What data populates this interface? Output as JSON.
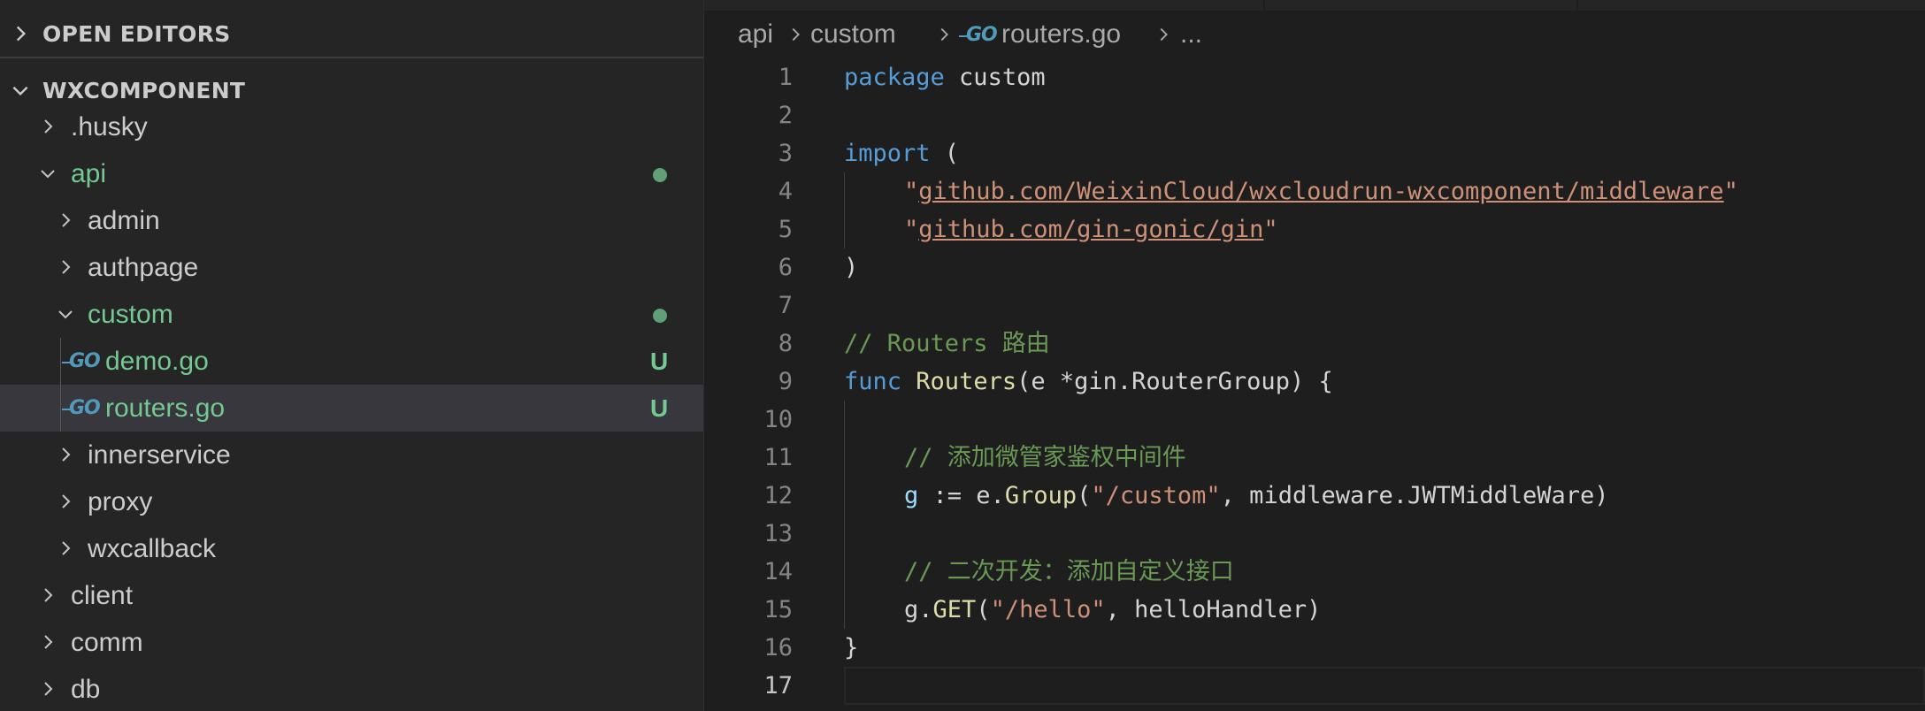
{
  "explorer": {
    "open_editors_label": "OPEN EDITORS",
    "workspace_label": "WXCOMPONENT",
    "items": [
      {
        "label": ".husky",
        "type": "folder",
        "expanded": false
      },
      {
        "label": "api",
        "type": "folder",
        "expanded": true,
        "modified": true
      },
      {
        "label": "admin",
        "type": "folder",
        "expanded": false
      },
      {
        "label": "authpage",
        "type": "folder",
        "expanded": false
      },
      {
        "label": "custom",
        "type": "folder",
        "expanded": true,
        "modified": true
      },
      {
        "label": "demo.go",
        "type": "go-file",
        "badge": "U"
      },
      {
        "label": "routers.go",
        "type": "go-file",
        "badge": "U",
        "selected": true
      },
      {
        "label": "innerservice",
        "type": "folder",
        "expanded": false
      },
      {
        "label": "proxy",
        "type": "folder",
        "expanded": false
      },
      {
        "label": "wxcallback",
        "type": "folder",
        "expanded": false
      },
      {
        "label": "client",
        "type": "folder",
        "expanded": false
      },
      {
        "label": "comm",
        "type": "folder",
        "expanded": false
      },
      {
        "label": "db",
        "type": "folder",
        "expanded": false
      }
    ],
    "go_icon_text": "GO"
  },
  "breadcrumb": {
    "items": [
      "api",
      "custom",
      "routers.go",
      "..."
    ]
  },
  "editor": {
    "line_numbers": [
      "1",
      "2",
      "3",
      "4",
      "5",
      "6",
      "7",
      "8",
      "9",
      "10",
      "11",
      "12",
      "13",
      "14",
      "15",
      "16",
      "17"
    ],
    "active_line": "17",
    "lines": {
      "l1": {
        "kw": "package",
        "rest": " custom"
      },
      "l3": {
        "kw": "import",
        "rest": " ("
      },
      "l4": {
        "q1": "\"",
        "url": "github.com/WeixinCloud/wxcloudrun-wxcomponent/middleware",
        "q2": "\""
      },
      "l5": {
        "q1": "\"",
        "url": "github.com/gin-gonic/gin",
        "q2": "\""
      },
      "l6": {
        "text": ")"
      },
      "l8": {
        "comment": "// Routers 路由"
      },
      "l9": {
        "kw": "func",
        "fn": "Routers",
        "p1": "(e *gin.RouterGroup) {"
      },
      "l11": {
        "comment": "// 添加微管家鉴权中间件"
      },
      "l12": {
        "var": "g",
        "op": " := e.",
        "fn": "Group",
        "p1": "(",
        "str": "\"/custom\"",
        "p2": ", middleware.JWTMiddleWare)"
      },
      "l14": {
        "comment": "// 二次开发：添加自定义接口"
      },
      "l15": {
        "p0": "g.",
        "fn": "GET",
        "p1": "(",
        "str": "\"/hello\"",
        "p2": ", helloHandler)"
      },
      "l16": {
        "text": "}"
      }
    }
  },
  "colors": {
    "background": "#1e1e1e",
    "sidebar": "#252526",
    "selected_row": "#37373d",
    "git_untracked": "#73c991",
    "keyword": "#569cd6",
    "function": "#dcdcaa",
    "string": "#ce9178",
    "comment": "#6a9955",
    "variable": "#9cdcfe"
  }
}
